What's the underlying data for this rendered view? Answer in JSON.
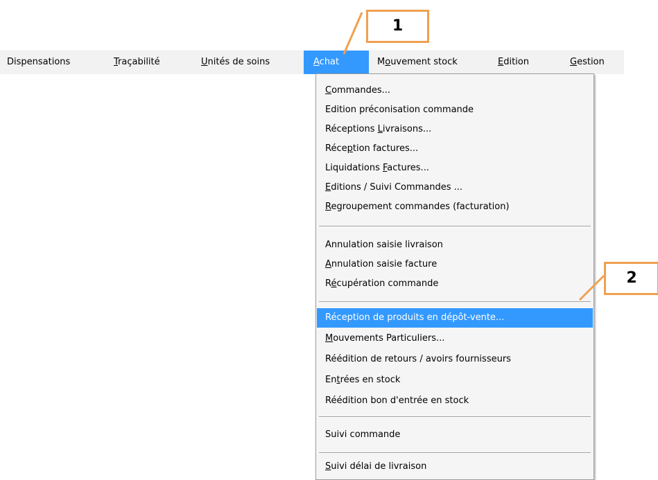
{
  "menubar": {
    "items": [
      {
        "pre": "",
        "mn": "",
        "post": "Dispensations"
      },
      {
        "pre": "",
        "mn": "T",
        "post": "raçabilité"
      },
      {
        "pre": "",
        "mn": "U",
        "post": "nités de soins"
      },
      {
        "pre": "",
        "mn": "A",
        "post": "chat"
      },
      {
        "pre": "M",
        "mn": "o",
        "post": "uvement stock"
      },
      {
        "pre": "",
        "mn": "E",
        "post": "dition"
      },
      {
        "pre": "",
        "mn": "G",
        "post": "estion"
      }
    ]
  },
  "dropdown": {
    "items": [
      {
        "pre": "",
        "mn": "C",
        "post": "ommandes..."
      },
      {
        "pre": "Edition préconisation commande",
        "mn": "",
        "post": ""
      },
      {
        "pre": "Réceptions ",
        "mn": "L",
        "post": "ivraisons..."
      },
      {
        "pre": "Réce",
        "mn": "p",
        "post": "tion factures..."
      },
      {
        "pre": "Liquidations ",
        "mn": "F",
        "post": "actures..."
      },
      {
        "pre": "",
        "mn": "E",
        "post": "ditions / Suivi Commandes ..."
      },
      {
        "pre": "",
        "mn": "R",
        "post": "egroupement commandes (facturation)"
      },
      {
        "pre": "Annulation saisie livraison",
        "mn": "",
        "post": ""
      },
      {
        "pre": "",
        "mn": "A",
        "post": "nnulation saisie facture"
      },
      {
        "pre": "R",
        "mn": "é",
        "post": "cupération commande"
      },
      {
        "pre": "Réception de produits en dépôt-vente...",
        "mn": "",
        "post": ""
      },
      {
        "pre": "",
        "mn": "M",
        "post": "ouvements Particuliers..."
      },
      {
        "pre": "Réédition de retours / avoirs fournisseurs",
        "mn": "",
        "post": ""
      },
      {
        "pre": "En",
        "mn": "t",
        "post": "rées en stock"
      },
      {
        "pre": "Réédition bon d'entrée en stock",
        "mn": "",
        "post": ""
      },
      {
        "pre": "Suivi commande",
        "mn": "",
        "post": ""
      },
      {
        "pre": "",
        "mn": "S",
        "post": "uivi délai de livraison"
      }
    ]
  },
  "callouts": {
    "one": "1",
    "two": "2"
  },
  "colors": {
    "highlight": "#3399ff",
    "callout_border": "#f0a050",
    "menu_background": "#f2f2f2",
    "dropdown_background": "#f5f5f5"
  }
}
